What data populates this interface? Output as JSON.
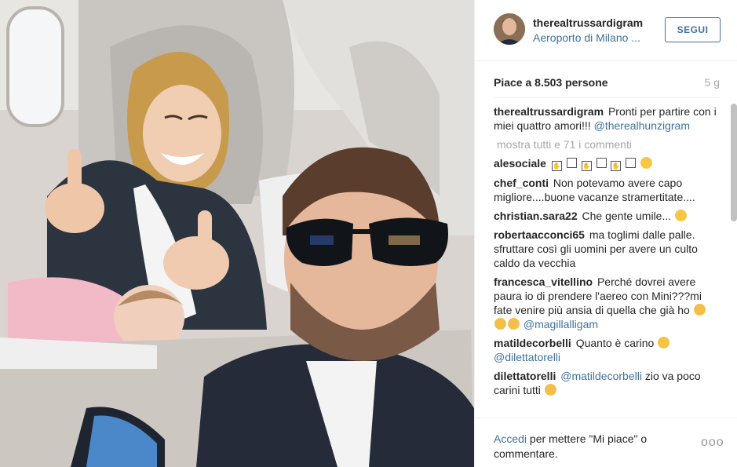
{
  "post": {
    "username": "therealtrussardigram",
    "location": "Aeroporto di Milano ...",
    "follow_label": "SEGUI",
    "likes": "Piace a 8.503 persone",
    "age": "5 g"
  },
  "comments": [
    {
      "user": "therealtrussardigram",
      "text": "Pronti per partire con i miei quattro amori!!!",
      "mention": "@therealhunzigram"
    },
    {
      "view_all": "mostra tutti e 71 i commenti"
    },
    {
      "user": "alesociale",
      "text": "",
      "emoji": [
        "hand",
        "box",
        "hand",
        "box",
        "hand",
        "box",
        "smile"
      ]
    },
    {
      "user": "chef_conti",
      "text": "Non potevamo avere capo migliore....buone vacanze stramertitate...."
    },
    {
      "user": "christian.sara22",
      "text": "Che gente umile...",
      "emoji": [
        "smile"
      ]
    },
    {
      "user": "robertaacconci65",
      "text": "ma toglimi dalle palle. sfruttare così gli uomini per avere un culto caldo da vecchia"
    },
    {
      "user": "francesca_vitellino",
      "text": "Perché dovrei avere paura io di prendere l'aereo con Mini???mi fate venire più ansia di quella che già ho",
      "emoji": [
        "scream",
        "scream",
        "scream"
      ],
      "mention": "@magillalligam"
    },
    {
      "user": "matildecorbelli",
      "text": "Quanto è carino",
      "emoji": [
        "hearteyes"
      ],
      "mention": "@dilettatorelli"
    },
    {
      "user": "dilettatorelli",
      "text": "zio va poco carini tutti",
      "mention_before": "@matildecorbelli",
      "emoji": [
        "scream"
      ]
    }
  ],
  "footer": {
    "login_link": "Accedi",
    "login_text": "per mettere \"Mi piace\" o commentare.",
    "more_label": "ooo"
  },
  "icons": {
    "more": "more-options-icon"
  },
  "colors": {
    "link": "#3f729b",
    "muted": "#a5a7aa",
    "text": "#262626"
  }
}
